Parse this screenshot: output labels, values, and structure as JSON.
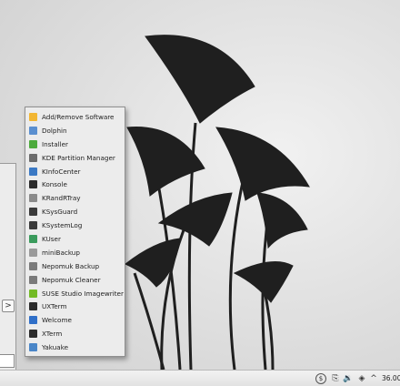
{
  "menu": {
    "items": [
      {
        "label": "Add/Remove Software",
        "icon": "package-icon",
        "color": "#f2b632"
      },
      {
        "label": "Dolphin",
        "icon": "folder-icon",
        "color": "#5a8fd0"
      },
      {
        "label": "Installer",
        "icon": "installer-icon",
        "color": "#4caa3c"
      },
      {
        "label": "KDE Partition Manager",
        "icon": "partition-icon",
        "color": "#6b6b6b"
      },
      {
        "label": "KInfoCenter",
        "icon": "info-icon",
        "color": "#3b79c4"
      },
      {
        "label": "Konsole",
        "icon": "terminal-icon",
        "color": "#2b2b2b"
      },
      {
        "label": "KRandRTray",
        "icon": "display-icon",
        "color": "#8a8a8a"
      },
      {
        "label": "KSysGuard",
        "icon": "monitor-icon",
        "color": "#3a3a3a"
      },
      {
        "label": "KSystemLog",
        "icon": "log-icon",
        "color": "#3a3a3a"
      },
      {
        "label": "KUser",
        "icon": "users-icon",
        "color": "#3a9b5c"
      },
      {
        "label": "miniBackup",
        "icon": "backup-icon",
        "color": "#9a9a9a"
      },
      {
        "label": "Nepomuk Backup",
        "icon": "nepomuk-icon",
        "color": "#7a7a7a"
      },
      {
        "label": "Nepomuk Cleaner",
        "icon": "nepomuk-icon",
        "color": "#7a7a7a"
      },
      {
        "label": "SUSE Studio Imagewriter",
        "icon": "suse-icon",
        "color": "#73ba25"
      },
      {
        "label": "UXTerm",
        "icon": "terminal-icon",
        "color": "#2b2b2b"
      },
      {
        "label": "Welcome",
        "icon": "globe-icon",
        "color": "#2f6fc8"
      },
      {
        "label": "XTerm",
        "icon": "terminal-icon",
        "color": "#2b2b2b"
      },
      {
        "label": "Yakuake",
        "icon": "dropdown-terminal-icon",
        "color": "#4a86c8"
      }
    ]
  },
  "launcher": {
    "arrow": ">"
  },
  "tray": {
    "clock": "36.00",
    "icons": {
      "updates": "$",
      "clipboard": "⎘",
      "volume": "🔉",
      "network": "◈",
      "expand": "^"
    }
  }
}
